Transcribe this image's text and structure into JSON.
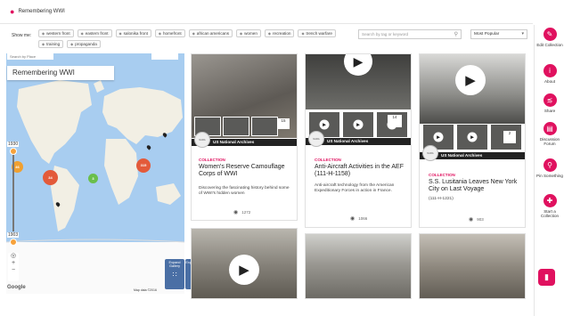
{
  "header": {
    "title": "Remembering WWI",
    "pin_icon": "map-pin-icon"
  },
  "filters": {
    "label": "Show me:",
    "tags": [
      "western front",
      "eastern front",
      "salonika front",
      "homefront",
      "african americans",
      "women",
      "recreation",
      "trench warfare",
      "training",
      "propaganda"
    ],
    "search_placeholder": "Search by tag or keyword",
    "sort_value": "Most Popular"
  },
  "map": {
    "search_hint": "Search by Place",
    "title": "Remembering WWI",
    "timeline_start": "1930",
    "timeline_end": "1903",
    "clusters": [
      "46",
      "34",
      "3",
      "315"
    ],
    "google_label": "Google",
    "map_data": "Map data ©2016",
    "expand_gallery": "Expand Gallery",
    "expand_map": "Expand Map"
  },
  "cards": [
    {
      "type": "COLLECTION",
      "title": "Women's Reserve Camouflage Corps of WWI",
      "description": "Discovering the fascinating history behind some of WWI's hidden women",
      "source": "US National Archives",
      "item_count": "15",
      "views": "1272"
    },
    {
      "type": "COLLECTION",
      "title": "Anti-Aircraft Activities in the AEF (111-H-1158)",
      "description": "Anti-aircraft technology from the American Expeditionary Forces in action in France.",
      "source": "US National Archives",
      "item_count": "14",
      "views": "1066"
    },
    {
      "type": "COLLECTION",
      "title": "S.S. Lusitania Leaves New York City on Last Voyage",
      "description": "(111-H-1221)",
      "source": "US National Archives",
      "item_count": "2",
      "views": "903"
    }
  ],
  "right_bar": [
    {
      "label": "Edit Collection",
      "icon": "pencil-icon"
    },
    {
      "label": "About",
      "icon": "info-icon"
    },
    {
      "label": "Share",
      "icon": "share-icon"
    },
    {
      "label": "Discussion Forum",
      "icon": "chat-icon"
    },
    {
      "label": "Pin Something",
      "icon": "pin-icon"
    },
    {
      "label": "Start a Collection",
      "icon": "collection-icon"
    }
  ],
  "colors": {
    "accent": "#e0115f",
    "map_water": "#a8cdf0",
    "land": "#f2efe4"
  }
}
